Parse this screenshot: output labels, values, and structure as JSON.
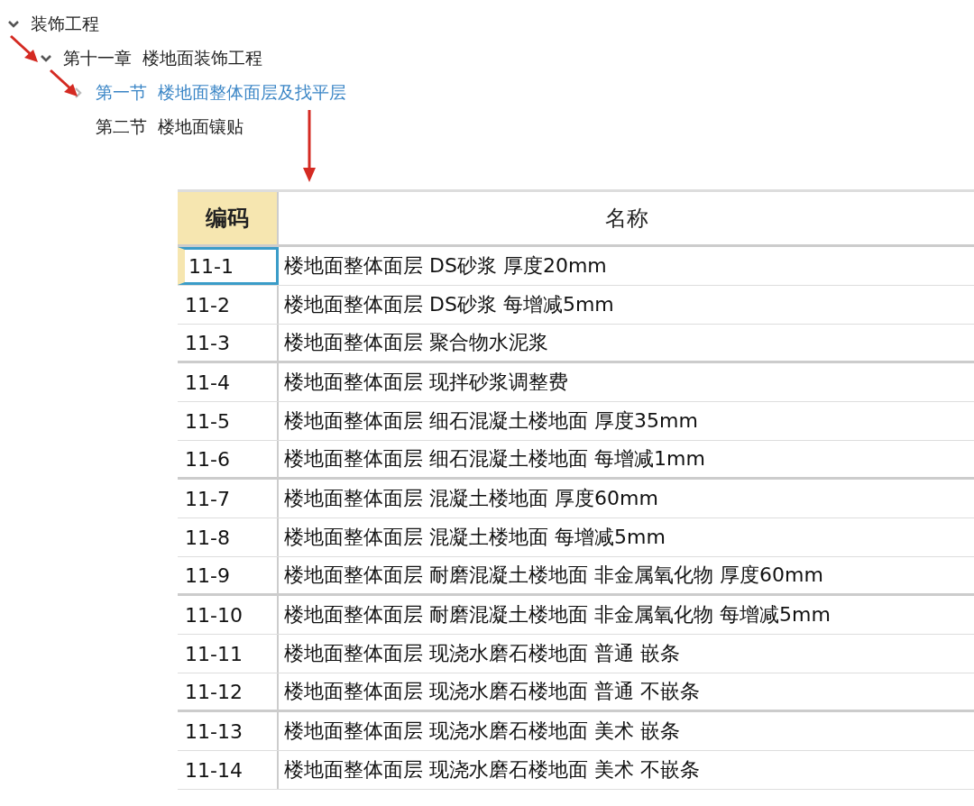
{
  "tree": [
    {
      "label": "装饰工程",
      "expanded": true,
      "selected": false,
      "children": [
        {
          "label": "第十一章  楼地面装饰工程",
          "expanded": true,
          "selected": false,
          "children": [
            {
              "label": "第一节  楼地面整体面层及找平层",
              "expanded": false,
              "selected": true
            },
            {
              "label": "第二节  楼地面镶贴",
              "selected": false
            }
          ]
        }
      ]
    }
  ],
  "table": {
    "columns": [
      {
        "label": "编码",
        "selected": true
      },
      {
        "label": "名称",
        "selected": false
      }
    ],
    "rows": [
      {
        "code": "11-1",
        "name": "楼地面整体面层 DS砂浆 厚度20mm",
        "selected": true
      },
      {
        "code": "11-2",
        "name": "楼地面整体面层 DS砂浆 每增减5mm",
        "selected": false
      },
      {
        "code": "11-3",
        "name": "楼地面整体面层 聚合物水泥浆",
        "selected": false
      },
      {
        "code": "11-4",
        "name": "楼地面整体面层 现拌砂浆调整费",
        "selected": false
      },
      {
        "code": "11-5",
        "name": "楼地面整体面层 细石混凝土楼地面 厚度35mm",
        "selected": false
      },
      {
        "code": "11-6",
        "name": "楼地面整体面层 细石混凝土楼地面 每增减1mm",
        "selected": false
      },
      {
        "code": "11-7",
        "name": "楼地面整体面层 混凝土楼地面 厚度60mm",
        "selected": false
      },
      {
        "code": "11-8",
        "name": "楼地面整体面层 混凝土楼地面 每增减5mm",
        "selected": false
      },
      {
        "code": "11-9",
        "name": "楼地面整体面层 耐磨混凝土楼地面 非金属氧化物 厚度60mm",
        "selected": false
      },
      {
        "code": "11-10",
        "name": "楼地面整体面层 耐磨混凝土楼地面 非金属氧化物 每增减5mm",
        "selected": false
      },
      {
        "code": "11-11",
        "name": "楼地面整体面层 现浇水磨石楼地面 普通 嵌条",
        "selected": false
      },
      {
        "code": "11-12",
        "name": "楼地面整体面层 现浇水磨石楼地面 普通 不嵌条",
        "selected": false
      },
      {
        "code": "11-13",
        "name": "楼地面整体面层 现浇水磨石楼地面 美术 嵌条",
        "selected": false
      },
      {
        "code": "11-14",
        "name": "楼地面整体面层 现浇水磨石楼地面 美术 不嵌条",
        "selected": false
      }
    ]
  }
}
